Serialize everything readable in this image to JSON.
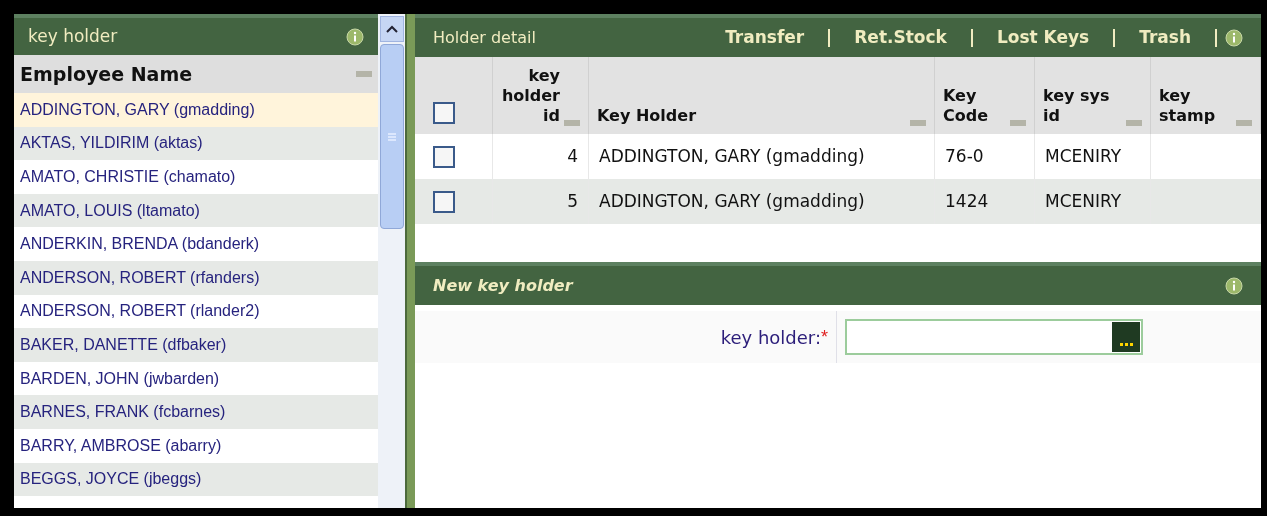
{
  "left_panel": {
    "title": "key holder",
    "column": "Employee Name",
    "employees": [
      {
        "name": "ADDINGTON, GARY (gmadding)",
        "selected": true
      },
      {
        "name": "AKTAS, YILDIRIM (aktas)",
        "selected": false
      },
      {
        "name": "AMATO, CHRISTIE (chamato)",
        "selected": false
      },
      {
        "name": "AMATO, LOUIS (ltamato)",
        "selected": false
      },
      {
        "name": "ANDERKIN, BRENDA (bdanderk)",
        "selected": false
      },
      {
        "name": "ANDERSON, ROBERT (rfanders)",
        "selected": false
      },
      {
        "name": "ANDERSON, ROBERT (rlander2)",
        "selected": false
      },
      {
        "name": "BAKER, DANETTE (dfbaker)",
        "selected": false
      },
      {
        "name": "BARDEN, JOHN (jwbarden)",
        "selected": false
      },
      {
        "name": "BARNES, FRANK (fcbarnes)",
        "selected": false
      },
      {
        "name": "BARRY, AMBROSE (abarry)",
        "selected": false
      },
      {
        "name": "BEGGS, JOYCE (jbeggs)",
        "selected": false
      }
    ]
  },
  "detail": {
    "title": "Holder detail",
    "actions": [
      "Transfer",
      "Ret.Stock",
      "Lost Keys",
      "Trash"
    ],
    "select_all_checked": false,
    "columns": [
      "key holder id",
      "Key Holder",
      "Key Code",
      "key sys id",
      "key stamp"
    ],
    "rows": [
      {
        "checked": false,
        "cells": [
          "4",
          "ADDINGTON, GARY (gmadding)",
          "76-0",
          "MCENIRY"
        ]
      },
      {
        "checked": false,
        "cells": [
          "5",
          "ADDINGTON, GARY (gmadding)",
          "1424",
          "MCENIRY"
        ]
      }
    ]
  },
  "new_holder": {
    "title": "New key holder",
    "field_label": "key holder:",
    "required": true,
    "required_marker": "*"
  }
}
